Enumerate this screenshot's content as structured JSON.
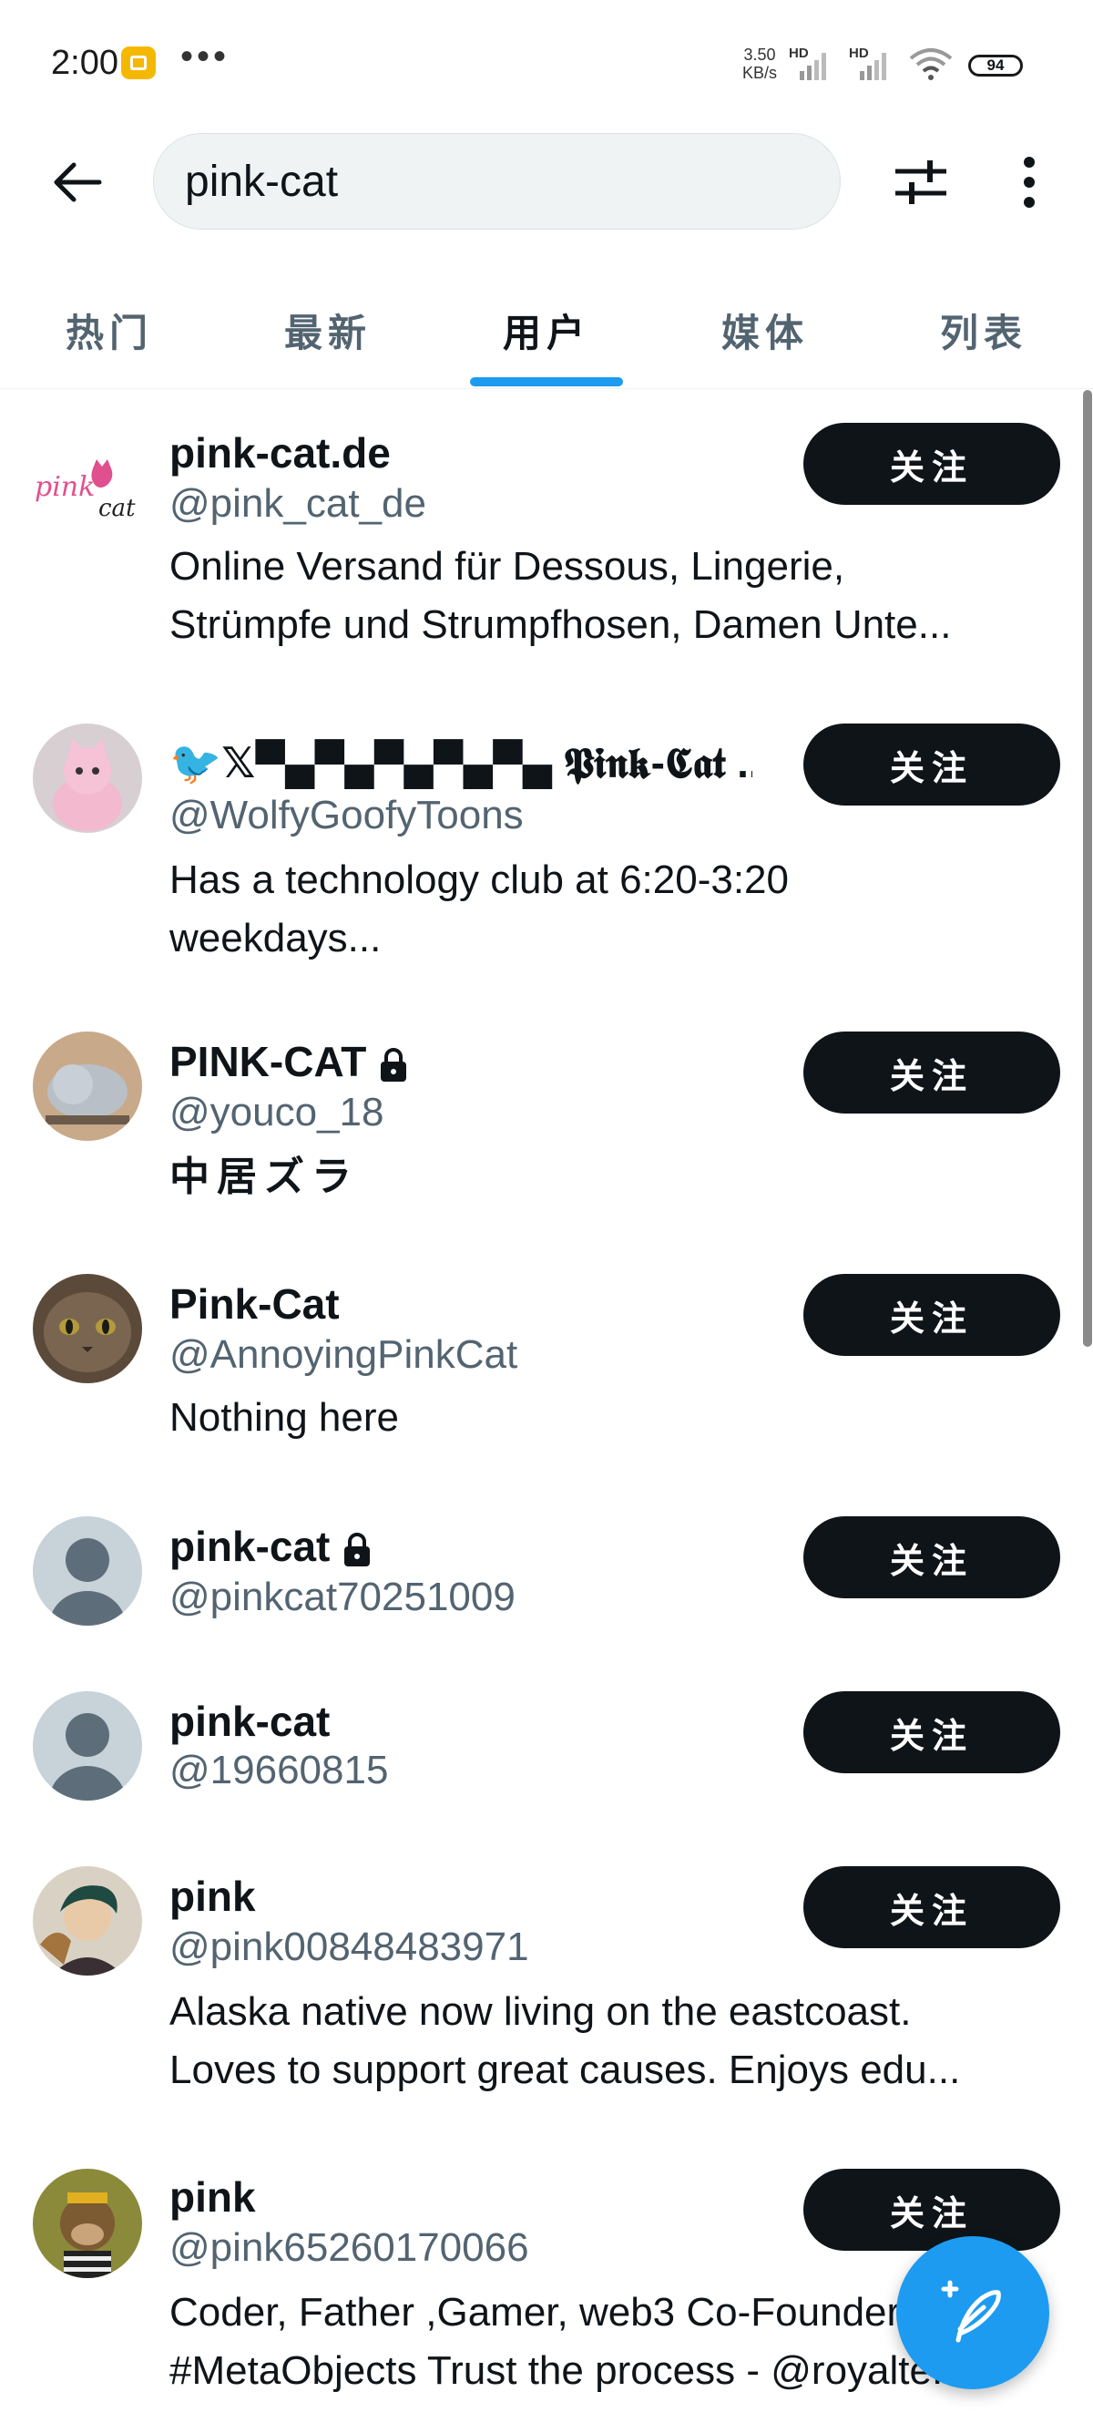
{
  "status_bar": {
    "time": "2:00",
    "dots": "•••",
    "net_speed_value": "3.50",
    "net_speed_unit": "KB/s",
    "hd1": "HD",
    "hd2": "HD",
    "battery": "94"
  },
  "search": {
    "query": "pink-cat"
  },
  "tabs": [
    {
      "label": "热门"
    },
    {
      "label": "最新"
    },
    {
      "label": "用户"
    },
    {
      "label": "媒体"
    },
    {
      "label": "列表"
    }
  ],
  "follow_label": "关注",
  "users": [
    {
      "name": "pink-cat.de",
      "handle": "@pink_cat_de",
      "bio1": "Online Versand für Dessous, Lingerie,",
      "bio2": "Strümpfe und Strumpfhosen, Damen Unte...",
      "logo_text": "pink",
      "logo_sub": "cat"
    },
    {
      "name": "🐦𝕏▀▄▀▄▀▄▀▄▀▄ 𝕻𝖎𝖓𝖐-𝕮𝖆𝖙 ...",
      "handle": "@WolfyGoofyToons",
      "bio1": "Has a technology club at 6:20-3:20",
      "bio2": "weekdays..."
    },
    {
      "name": "PINK-CAT",
      "handle": "@youco_18",
      "bio1": "中居ズラ",
      "locked": true
    },
    {
      "name": "Pink-Cat",
      "handle": "@AnnoyingPinkCat",
      "bio1": "Nothing here"
    },
    {
      "name": "pink-cat",
      "handle": "@pinkcat70251009",
      "locked": true
    },
    {
      "name": "pink-cat",
      "handle": "@19660815"
    },
    {
      "name": "pink",
      "handle": "@pink00848483971",
      "bio1": "Alaska native now living on the eastcoast.",
      "bio2": "Loves to support great causes. Enjoys edu..."
    },
    {
      "name": "pink",
      "handle": "@pink65260170066",
      "bio1": "Coder, Father ,Gamer, web3 Co-Founder",
      "bio2": "#MetaObjects Trust the process - @royalte..."
    }
  ],
  "colors": {
    "accent": "#1d9bf0",
    "text": "#0f1419",
    "secondary": "#536471",
    "button": "#0f1419"
  },
  "icons": {
    "back": "arrow-left-icon",
    "filter": "sliders-icon",
    "more": "more-vertical-icon",
    "lock": "lock-icon",
    "compose": "compose-feather-icon"
  }
}
